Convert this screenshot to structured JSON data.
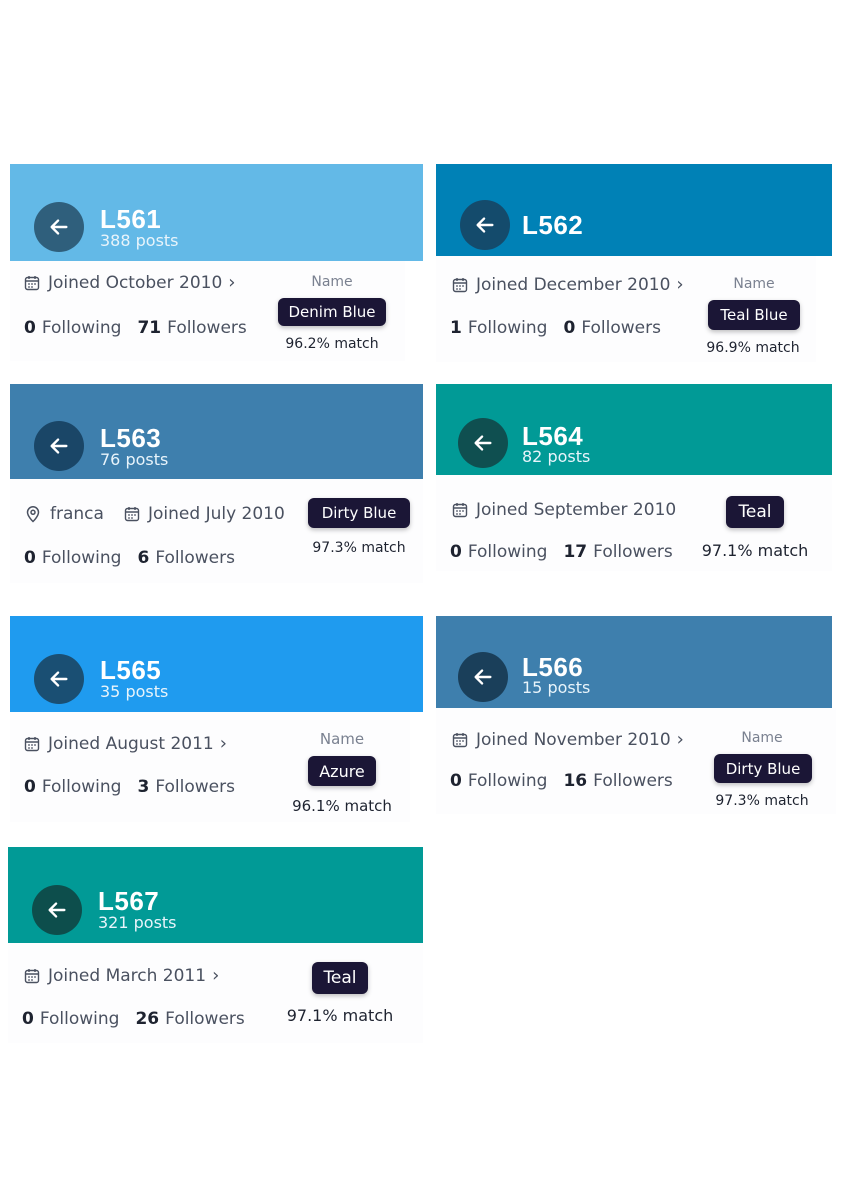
{
  "cards": [
    {
      "id": "L561",
      "posts": "388 posts",
      "joined": "Joined October 2010",
      "chevron": true,
      "following": "0",
      "following_label": "Following",
      "followers": "71",
      "followers_label": "Followers",
      "name_label": "Name",
      "badge": "Denim Blue",
      "match": "96.2% match",
      "color": "#63b9e7"
    },
    {
      "id": "L562",
      "posts": "",
      "joined": "Joined December 2010",
      "chevron": true,
      "following": "1",
      "following_label": "Following",
      "followers": "0",
      "followers_label": "Followers",
      "name_label": "Name",
      "badge": "Teal Blue",
      "match": "96.9% match",
      "color": "#0081b6"
    },
    {
      "id": "L563",
      "posts": "76 posts",
      "location": "franca",
      "joined": "Joined July 2010",
      "chevron": false,
      "following": "0",
      "following_label": "Following",
      "followers": "6",
      "followers_label": "Followers",
      "name_label": "",
      "badge": "Dirty Blue",
      "match": "97.3% match",
      "color": "#3e7fad"
    },
    {
      "id": "L564",
      "posts": "82 posts",
      "joined": "Joined September 2010",
      "chevron": false,
      "following": "0",
      "following_label": "Following",
      "followers": "17",
      "followers_label": "Followers",
      "name_label": "",
      "badge": "Teal",
      "match": "97.1% match",
      "color": "#019a96"
    },
    {
      "id": "L565",
      "posts": "35 posts",
      "joined": "Joined August 2011",
      "chevron": true,
      "following": "0",
      "following_label": "Following",
      "followers": "3",
      "followers_label": "Followers",
      "name_label": "Name",
      "badge": "Azure",
      "match": "96.1% match",
      "color": "#1f9bef"
    },
    {
      "id": "L566",
      "posts": "15 posts",
      "joined": "Joined November 2010",
      "chevron": true,
      "following": "0",
      "following_label": "Following",
      "followers": "16",
      "followers_label": "Followers",
      "name_label": "Name",
      "badge": "Dirty Blue",
      "match": "97.3% match",
      "color": "#3e7fad"
    },
    {
      "id": "L567",
      "posts": "321 posts",
      "joined": "Joined March 2011",
      "chevron": true,
      "following": "0",
      "following_label": "Following",
      "followers": "26",
      "followers_label": "Followers",
      "name_label": "",
      "badge": "Teal",
      "match": "97.1% match",
      "color": "#019a96"
    }
  ]
}
